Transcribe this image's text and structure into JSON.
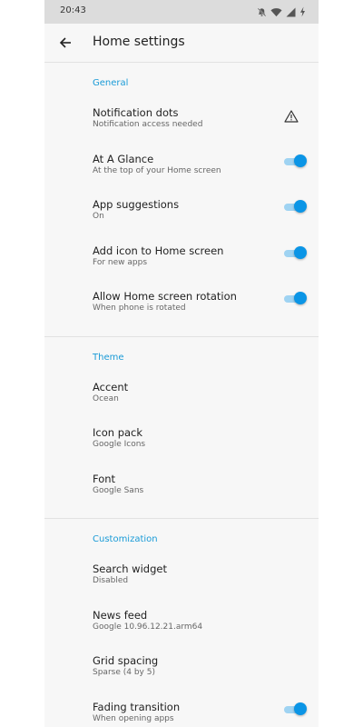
{
  "status_bar": {
    "time": "20:43",
    "icons": [
      "bell-off-icon",
      "wifi-icon",
      "signal-icon",
      "battery-charging-icon"
    ]
  },
  "app_bar": {
    "title": "Home settings",
    "back_icon": "arrow-left-icon"
  },
  "colors": {
    "accent": "#1a9bd7",
    "toggle_thumb": "#0b95e6",
    "toggle_track": "#9fd3f2",
    "background": "#f7f7f7"
  },
  "sections": [
    {
      "header": "General",
      "items": [
        {
          "title": "Notification dots",
          "subtitle": "Notification access needed",
          "control": "warning-icon"
        },
        {
          "title": "At A Glance",
          "subtitle": "At the top of your Home screen",
          "control": "toggle",
          "checked": true
        },
        {
          "title": "App suggestions",
          "subtitle": "On",
          "control": "toggle",
          "checked": true
        },
        {
          "title": "Add icon to Home screen",
          "subtitle": "For new apps",
          "control": "toggle",
          "checked": true
        },
        {
          "title": "Allow Home screen rotation",
          "subtitle": "When phone is rotated",
          "control": "toggle",
          "checked": true
        }
      ]
    },
    {
      "header": "Theme",
      "items": [
        {
          "title": "Accent",
          "subtitle": "Ocean"
        },
        {
          "title": "Icon pack",
          "subtitle": "Google Icons"
        },
        {
          "title": "Font",
          "subtitle": "Google Sans"
        }
      ]
    },
    {
      "header": "Customization",
      "items": [
        {
          "title": "Search widget",
          "subtitle": "Disabled"
        },
        {
          "title": "News feed",
          "subtitle": "Google 10.96.12.21.arm64"
        },
        {
          "title": "Grid spacing",
          "subtitle": "Sparse (4 by 5)"
        },
        {
          "title": "Fading transition",
          "subtitle": "When opening apps",
          "control": "toggle",
          "checked": true
        }
      ]
    }
  ]
}
